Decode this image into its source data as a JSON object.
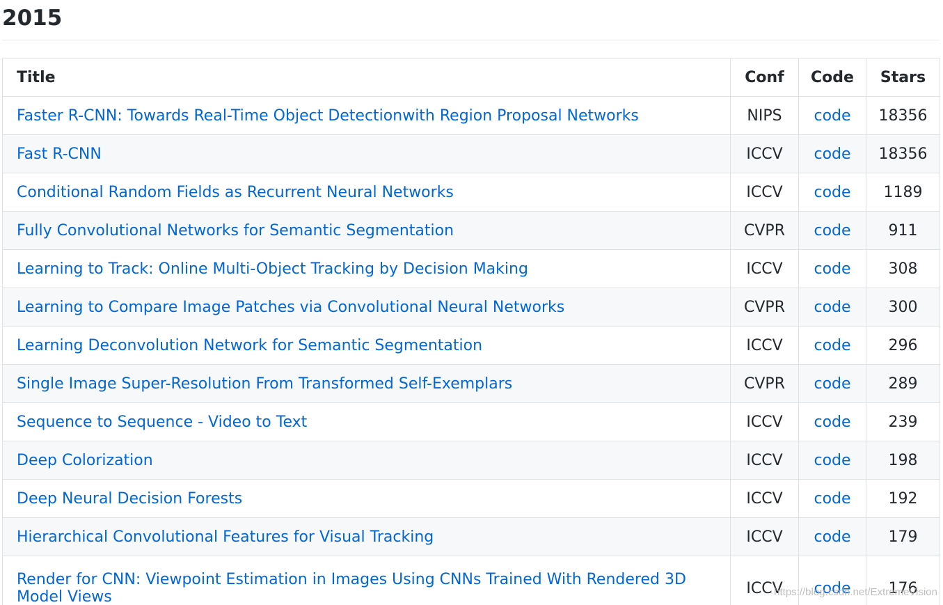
{
  "section": {
    "year": "2015"
  },
  "table": {
    "headers": {
      "title": "Title",
      "conf": "Conf",
      "code": "Code",
      "stars": "Stars"
    },
    "rows": [
      {
        "title": "Faster R-CNN: Towards Real-Time Object Detectionwith Region Proposal Networks",
        "conf": "NIPS",
        "code": "code",
        "stars": "18356"
      },
      {
        "title": "Fast R-CNN",
        "conf": "ICCV",
        "code": "code",
        "stars": "18356"
      },
      {
        "title": "Conditional Random Fields as Recurrent Neural Networks",
        "conf": "ICCV",
        "code": "code",
        "stars": "1189"
      },
      {
        "title": "Fully Convolutional Networks for Semantic Segmentation",
        "conf": "CVPR",
        "code": "code",
        "stars": "911"
      },
      {
        "title": "Learning to Track: Online Multi-Object Tracking by Decision Making",
        "conf": "ICCV",
        "code": "code",
        "stars": "308"
      },
      {
        "title": "Learning to Compare Image Patches via Convolutional Neural Networks",
        "conf": "CVPR",
        "code": "code",
        "stars": "300"
      },
      {
        "title": "Learning Deconvolution Network for Semantic Segmentation",
        "conf": "ICCV",
        "code": "code",
        "stars": "296"
      },
      {
        "title": "Single Image Super-Resolution From Transformed Self-Exemplars",
        "conf": "CVPR",
        "code": "code",
        "stars": "289"
      },
      {
        "title": "Sequence to Sequence - Video to Text",
        "conf": "ICCV",
        "code": "code",
        "stars": "239"
      },
      {
        "title": "Deep Colorization",
        "conf": "ICCV",
        "code": "code",
        "stars": "198"
      },
      {
        "title": "Deep Neural Decision Forests",
        "conf": "ICCV",
        "code": "code",
        "stars": "192"
      },
      {
        "title": "Hierarchical Convolutional Features for Visual Tracking",
        "conf": "ICCV",
        "code": "code",
        "stars": "179"
      },
      {
        "title": "Render for CNN: Viewpoint Estimation in Images Using CNNs Trained With Rendered 3D Model Views",
        "conf": "ICCV",
        "code": "code",
        "stars": "176"
      }
    ]
  },
  "watermark": "https://blog.csdn.net/ExtremeVision",
  "colors": {
    "link": "#0366d6",
    "text": "#24292e",
    "border": "#dfe2e5",
    "stripe": "#f6f8fa"
  }
}
